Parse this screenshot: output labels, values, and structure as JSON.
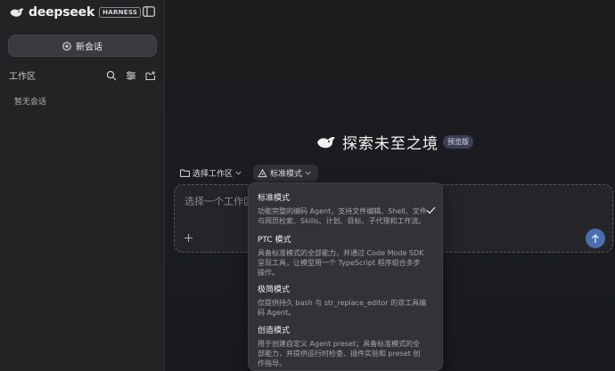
{
  "sidebar": {
    "brand_name": "deepseek",
    "brand_badge": "HARNESS",
    "new_chat_label": "新会话",
    "workspace_label": "工作区",
    "empty_text": "暂无会话"
  },
  "main": {
    "hero_title": "探索未至之境",
    "preview_badge": "预览版",
    "select_workspace_label": "选择工作区",
    "mode_label": "标准模式",
    "composer_placeholder": "选择一个工作区"
  },
  "dropdown": {
    "options": [
      {
        "title": "标准模式",
        "desc": "功能完整的编码 Agent，支持文件编辑、Shell、文件与网页检索、Skills、计划、目标、子代理和工作流。",
        "selected": true
      },
      {
        "title": "PTC 模式",
        "desc": "具备标准模式的全部能力，并通过 Code Mode SDK 呈现工具，让模型用一个 TypeScript 程序组合多步操作。",
        "selected": false
      },
      {
        "title": "极简模式",
        "desc": "仅提供持久 bash 与 str_replace_editor 的双工具编码 Agent。",
        "selected": false
      },
      {
        "title": "创造模式",
        "desc": "用于创建自定义 Agent preset；具备标准模式的全部能力，并提供运行时检查、插件实验和 preset 创作指导。",
        "selected": false
      }
    ]
  },
  "colors": {
    "accent": "#4a6fae",
    "brand_blue": "#e8e8ec"
  },
  "icons": {
    "collapse": "sidebar-toggle-icon",
    "new_chat": "plus-circle-icon",
    "search": "search-icon",
    "filter": "sliders-icon",
    "new_folder": "new-folder-icon",
    "folder": "folder-icon",
    "mode": "recycle-icon",
    "check": "check-icon",
    "attach": "plus-icon",
    "send": "arrow-up-icon"
  }
}
